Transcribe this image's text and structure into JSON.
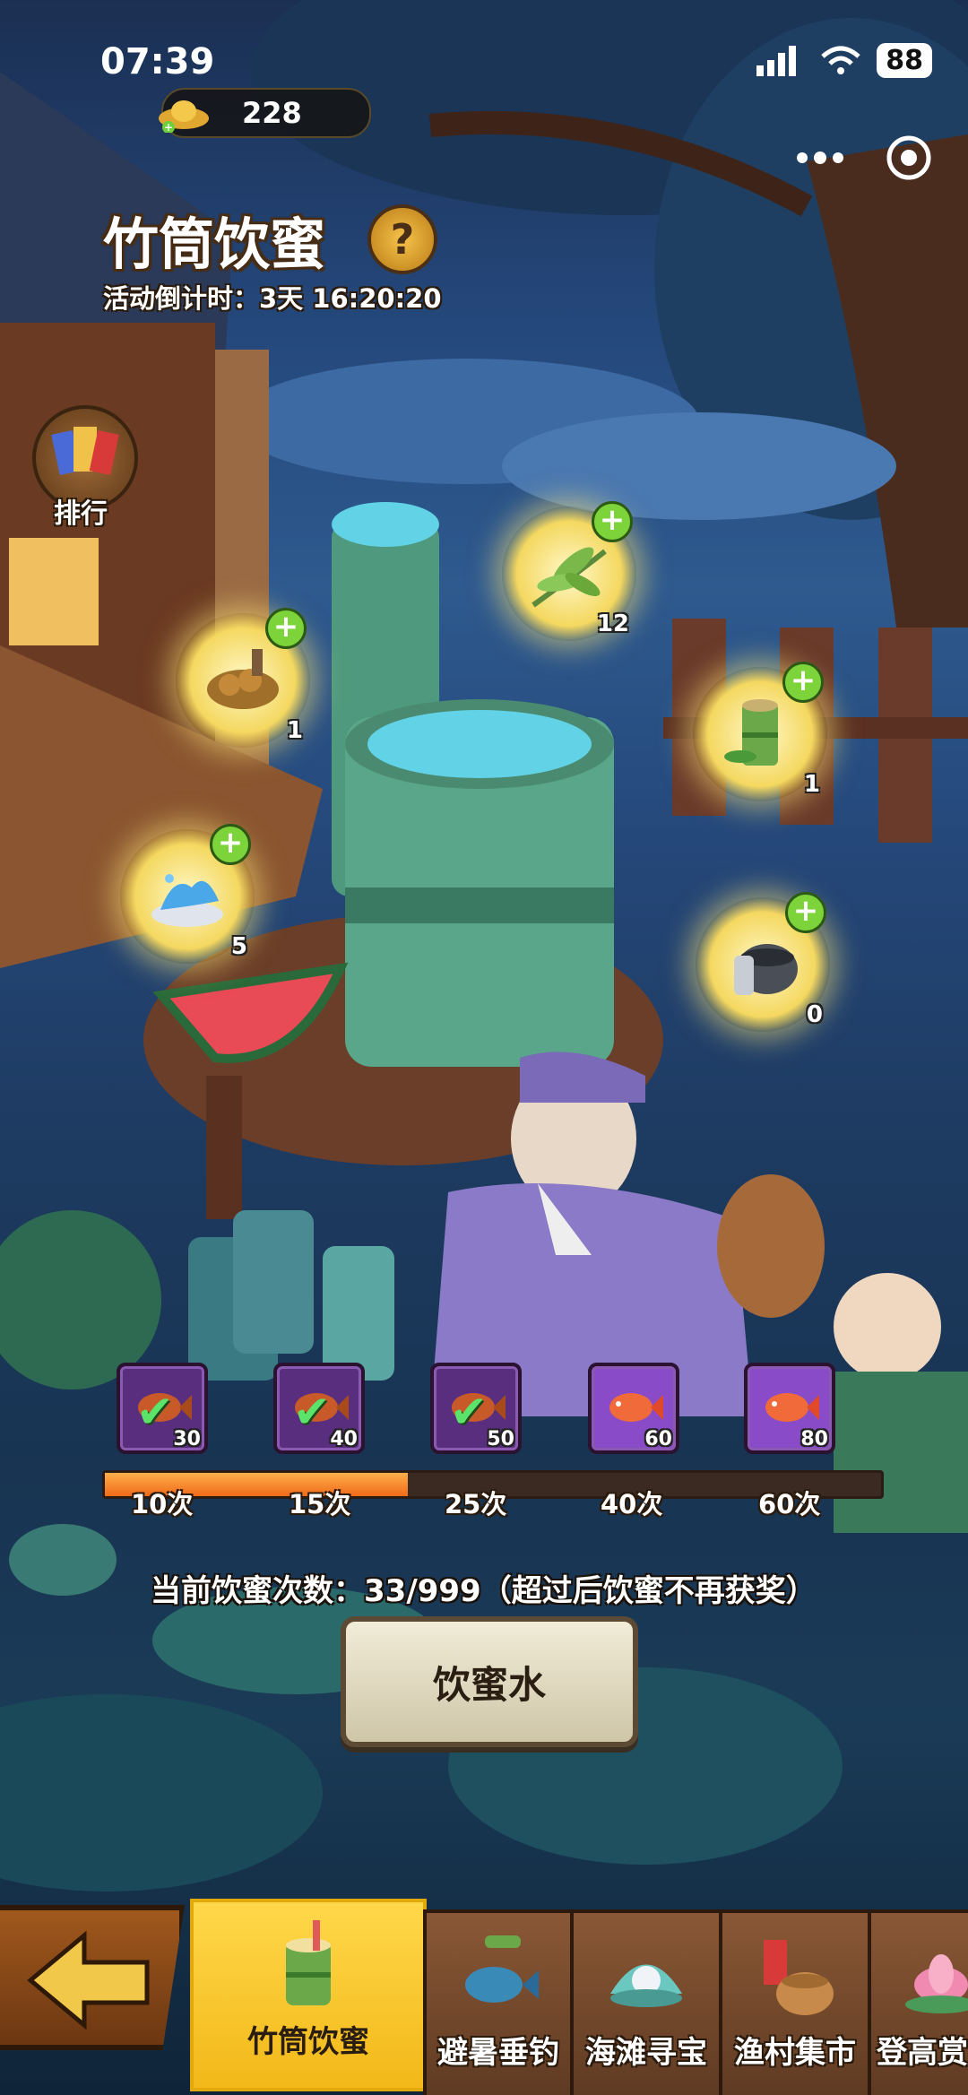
{
  "status_bar": {
    "time": "07:39",
    "battery": "88",
    "signal_icon": "signal-bars-icon",
    "wifi_icon": "wifi-icon"
  },
  "currency": {
    "amount": "228",
    "icon": "gold-ingot-icon",
    "add_icon": "plus-icon"
  },
  "header": {
    "title": "竹筒饮蜜",
    "countdown": "活动倒计时：3天 16:20:20",
    "help_icon": "question-mark-icon"
  },
  "menu": {
    "more_icon": "more-dots-icon",
    "close_icon": "target-circle-icon"
  },
  "rank": {
    "label": "排行",
    "icon": "ranking-cards-icon"
  },
  "ingredients": [
    {
      "name": "mushroom-nuts",
      "count": "1"
    },
    {
      "name": "bamboo-leaf",
      "count": "12"
    },
    {
      "name": "bamboo-tube",
      "count": "1"
    },
    {
      "name": "water-splash",
      "count": "5"
    },
    {
      "name": "mortar-pestle",
      "count": "0"
    }
  ],
  "rewards": [
    {
      "count": "30",
      "claimed": true,
      "icon": "fish-icon"
    },
    {
      "count": "40",
      "claimed": true,
      "icon": "fish-icon"
    },
    {
      "count": "50",
      "claimed": true,
      "icon": "fish-icon"
    },
    {
      "count": "60",
      "claimed": false,
      "icon": "fish-icon"
    },
    {
      "count": "80",
      "claimed": false,
      "icon": "fish-icon"
    }
  ],
  "milestones": [
    "10次",
    "15次",
    "25次",
    "40次",
    "60次"
  ],
  "progress": {
    "fill_fraction": 0.39
  },
  "drink_status": "当前饮蜜次数：33/999（超过后饮蜜不再获奖）",
  "drink_button": "饮蜜水",
  "tabs": [
    {
      "label": "竹筒饮蜜",
      "active": true
    },
    {
      "label": "避暑垂钓",
      "active": false
    },
    {
      "label": "海滩寻宝",
      "active": false
    },
    {
      "label": "渔村集市",
      "active": false
    },
    {
      "label": "登高赏",
      "active": false
    }
  ],
  "back_icon": "back-arrow-icon"
}
